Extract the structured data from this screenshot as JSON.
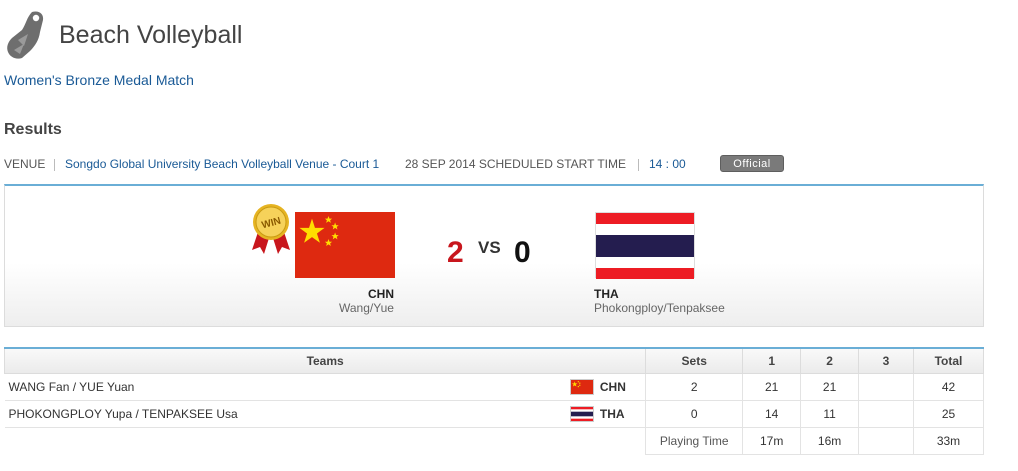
{
  "header": {
    "sport_icon": "volleyball-player-icon",
    "title": "Beach Volleyball"
  },
  "event": {
    "name": "Women's Bronze Medal Match"
  },
  "results": {
    "heading": "Results"
  },
  "venue_bar": {
    "venue_label": "VENUE",
    "venue_name": "Songdo Global University Beach Volleyball Venue - Court 1",
    "schedule_label": "28 SEP 2014 SCHEDULED START TIME",
    "start_time": "14 : 00",
    "status_badge": "Official"
  },
  "match": {
    "win_badge": "WIN",
    "vs_label": "VS",
    "home": {
      "code": "CHN",
      "players": "Wang/Yue",
      "score": "2"
    },
    "away": {
      "code": "THA",
      "players": "Phokongploy/Tenpaksee",
      "score": "0"
    }
  },
  "table": {
    "headers": {
      "teams": "Teams",
      "sets": "Sets",
      "set1": "1",
      "set2": "2",
      "set3": "3",
      "total": "Total"
    },
    "rows": [
      {
        "team": "WANG Fan / YUE Yuan",
        "code": "CHN",
        "sets": "2",
        "set1": "21",
        "set2": "21",
        "set3": "",
        "total": "42"
      },
      {
        "team": "PHOKONGPLOY Yupa / TENPAKSEE Usa",
        "code": "THA",
        "sets": "0",
        "set1": "14",
        "set2": "11",
        "set3": "",
        "total": "25"
      }
    ],
    "playing_time": {
      "label": "Playing Time",
      "set1": "17m",
      "set2": "16m",
      "set3": "",
      "total": "33m"
    }
  },
  "colors": {
    "link": "#1a5a96",
    "accent_border": "#6aaed6",
    "home_score": "#c8161d",
    "china_red": "#de2910",
    "china_star": "#ffde00",
    "thai_red": "#ed1c24",
    "thai_blue": "#241d4f"
  }
}
